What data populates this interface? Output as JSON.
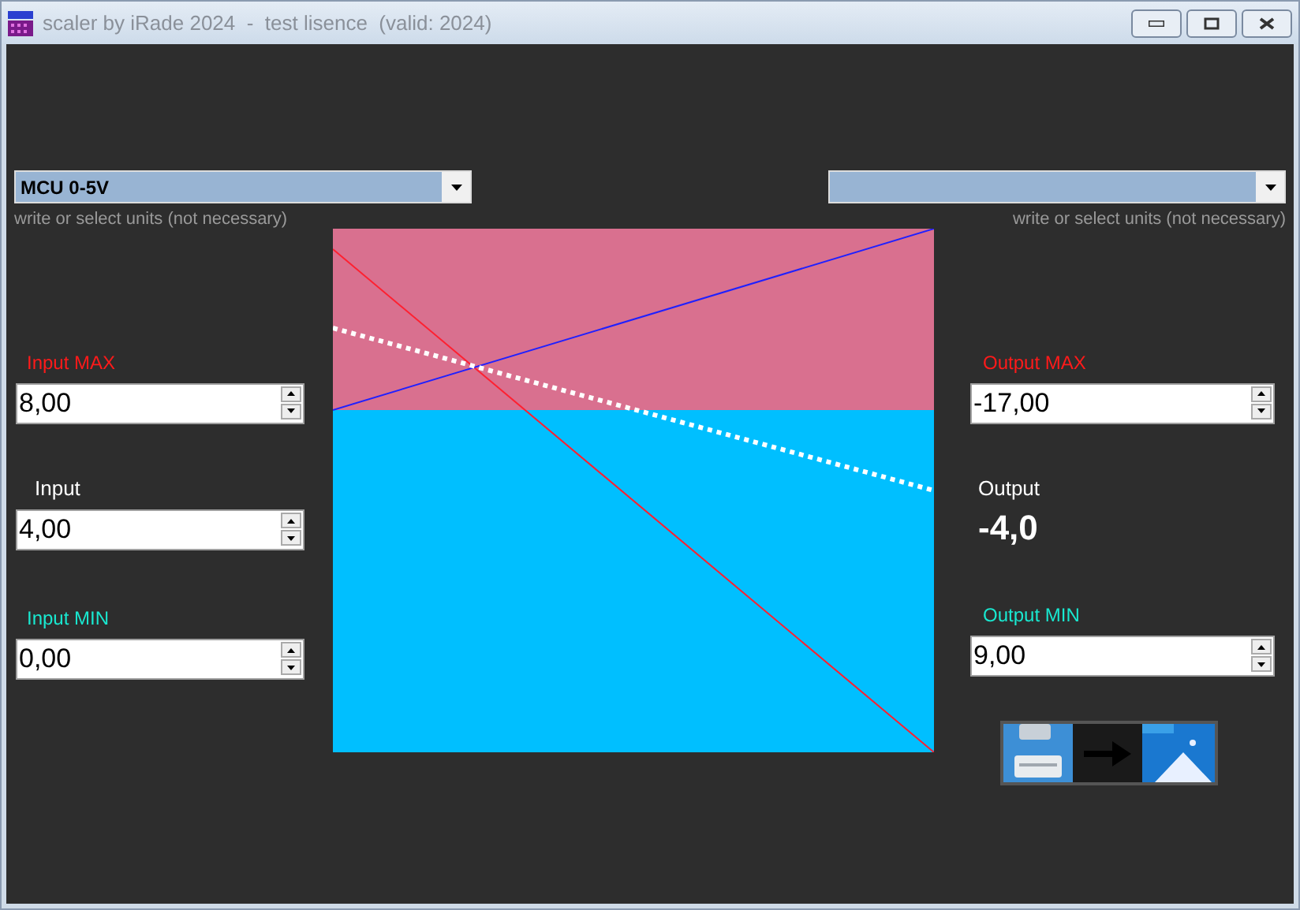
{
  "window": {
    "title": "scaler by iRade 2024  -  test lisence  (valid: 2024)"
  },
  "units_left": {
    "value": "MCU 0-5V",
    "hint": "write or select units (not necessary)"
  },
  "units_right": {
    "hint": "write or select units (not necessary)"
  },
  "inputs": [
    {
      "kind": "max",
      "label": "Input MAX",
      "value": "8,00"
    },
    {
      "kind": "value",
      "label": "Input",
      "value": "4,00"
    },
    {
      "kind": "min",
      "label": "Input MIN",
      "value": "0,00"
    }
  ],
  "outputs": [
    {
      "kind": "max",
      "label": "Output MAX",
      "value": "-17,00"
    },
    {
      "kind": "result",
      "label": "Output",
      "value": "-4,0"
    },
    {
      "kind": "min",
      "label": "Output MIN",
      "value": "9,00"
    }
  ]
}
